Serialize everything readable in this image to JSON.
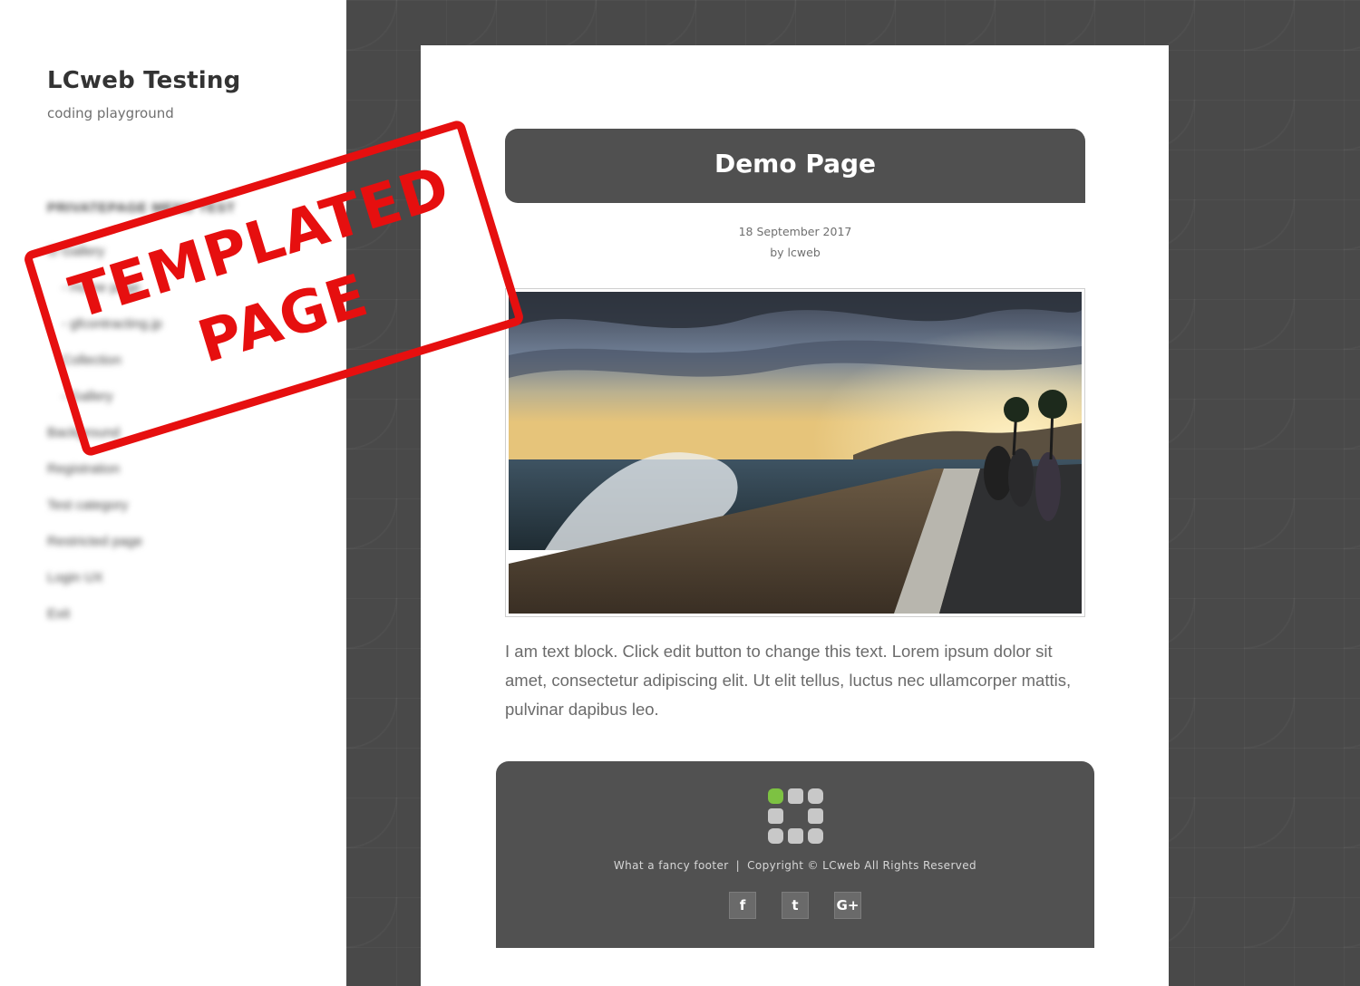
{
  "site": {
    "title": "LCweb Testing",
    "tagline": "coding playground"
  },
  "sidebar_menu": {
    "note": "menu items are blurred/unreadable in the screenshot",
    "items": [
      {
        "label": "PRIVATEPAGE MENU TEST",
        "heading": true
      },
      {
        "label": "G Gallery"
      },
      {
        "label": "- Home page"
      },
      {
        "label": "- gfcontracting.jp"
      },
      {
        "label": "Collection"
      },
      {
        "label": "- Gallery"
      },
      {
        "label": "Background"
      },
      {
        "label": "Registration"
      },
      {
        "label": "Test category"
      },
      {
        "label": "Restricted page"
      },
      {
        "label": "Login UX"
      },
      {
        "label": "Exit"
      }
    ]
  },
  "stamp": {
    "line1": "TEMPLATED",
    "line2": "PAGE",
    "color": "#e60f0f"
  },
  "page": {
    "title": "Demo Page",
    "date": "18 September 2017",
    "author": "by lcweb",
    "image_alt": "sunset-seaside-photo",
    "text": "I am text block. Click edit button to change this text. Lorem ipsum dolor sit amet, consectetur adipiscing elit. Ut elit tellus, luctus nec ullamcorper mattis, pulvinar dapibus leo."
  },
  "footer": {
    "left_text": "What a fancy footer",
    "separator": "|",
    "right_text": "Copyright © LCweb All Rights Reserved",
    "social": [
      {
        "name": "facebook",
        "glyph": "f"
      },
      {
        "name": "twitter",
        "glyph": "t"
      },
      {
        "name": "google-plus",
        "glyph": "G+"
      }
    ],
    "logo_accent": "#7dc242"
  },
  "colors": {
    "sidebar_bg": "#ffffff",
    "panel_bg": "#494949",
    "title_bar_bg": "#505050",
    "footer_bg": "#515151"
  }
}
